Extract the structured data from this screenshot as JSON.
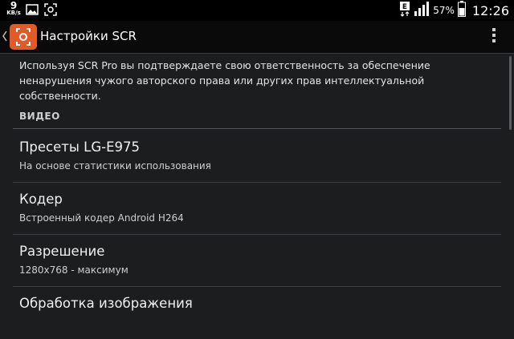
{
  "status_bar": {
    "net_speed": "9",
    "net_unit": "KB/s",
    "battery_percent": "57%",
    "time": "12:26",
    "icons": [
      "image-icon",
      "screen-recorder-icon",
      "data-e-icon",
      "signal-icon",
      "battery-icon"
    ]
  },
  "action_bar": {
    "title": "Настройки SCR",
    "icon": "scr-app-icon",
    "overflow_icon": "overflow-menu-icon"
  },
  "notice": "Используя SCR Pro вы подтверждаете свою ответственность за обеспечение ненарушения чужого авторского права или других прав интеллектуальной собственности.",
  "section": {
    "header": "ВИДЕО"
  },
  "prefs": [
    {
      "title": "Пресеты LG-E975",
      "summary": "На основе статистики использования"
    },
    {
      "title": "Кодер",
      "summary": "Встроенный кодер Android H264"
    },
    {
      "title": "Разрешение",
      "summary": "1280x768 - максимум"
    },
    {
      "title": "Обработка изображения",
      "summary": ""
    }
  ],
  "colors": {
    "accent": "#e05a2a",
    "background": "#1c1d1f"
  }
}
